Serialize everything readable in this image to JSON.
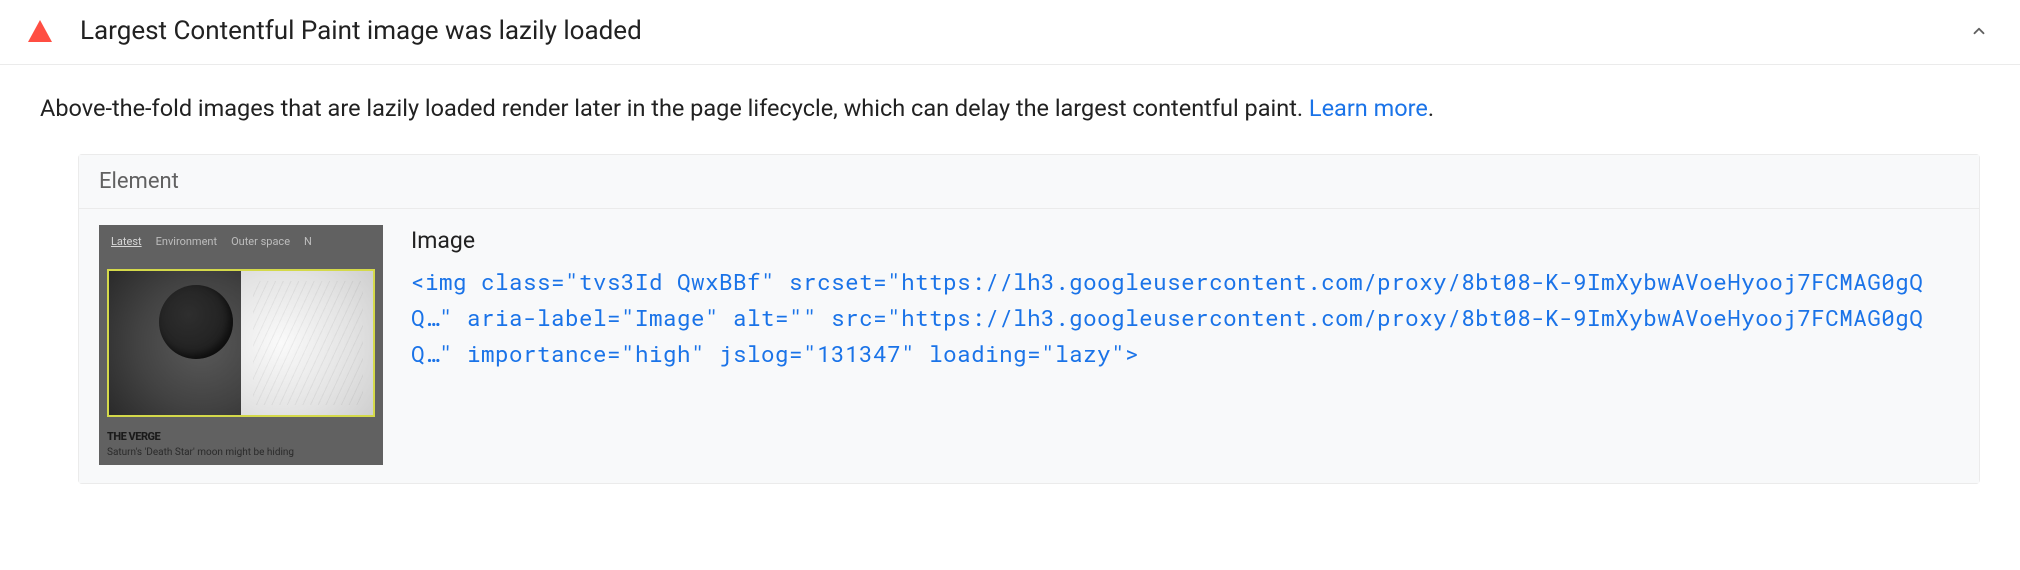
{
  "audit": {
    "title": "Largest Contentful Paint image was lazily loaded",
    "description_pre": "Above-the-fold images that are lazily loaded render later in the page lifecycle, which can delay the largest contentful paint. ",
    "learn_more": "Learn more",
    "description_post": "."
  },
  "table": {
    "header": "Element",
    "row": {
      "label": "Image",
      "thumbnail": {
        "tabs": [
          "Latest",
          "Environment",
          "Outer space",
          "N"
        ],
        "brand": "THE VERGE",
        "caption": "Saturn's 'Death Star' moon might be hiding"
      },
      "html": "<img class=\"tvs3Id QwxBBf\" srcset=\"https://lh3.googleusercontent.com/proxy/8bt08-K-9ImXybwAVoeHyooj7FCMAG0gQQ…\" aria-label=\"Image\" alt=\"\" src=\"https://lh3.googleusercontent.com/proxy/8bt08-K-9ImXybwAVoeHyooj7FCMAG0gQQ…\" importance=\"high\" jslog=\"131347\" loading=\"lazy\">"
    }
  }
}
